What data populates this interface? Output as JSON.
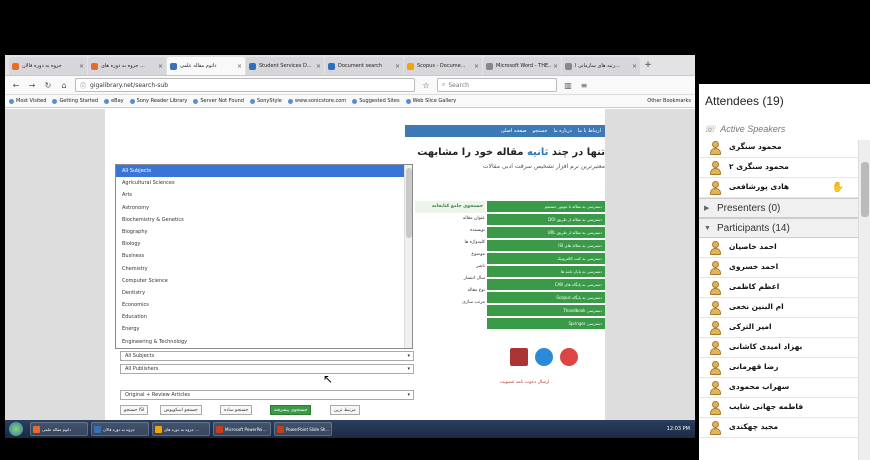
{
  "browser": {
    "tabs": [
      {
        "label": "جزوه به دوره فالان",
        "color": "#e86b2a",
        "active": false
      },
      {
        "label": "جزوه به دوره های ...",
        "color": "#e86b2a",
        "active": false
      },
      {
        "label": "داتوم مقاله علمی",
        "color": "#3b6fb6",
        "active": true
      },
      {
        "label": "Student Services D...",
        "color": "#2e6fbf",
        "active": false
      },
      {
        "label": "Document search",
        "color": "#2e6fbf",
        "active": false
      },
      {
        "label": "Scopus - Docume...",
        "color": "#f4a300",
        "active": false
      },
      {
        "label": "Microsoft Word - THE...",
        "color": "#888",
        "active": false
      },
      {
        "label": "رتبه های سازمانی ا...",
        "color": "#888",
        "active": false
      }
    ],
    "url": "gigalibrary.net/search-sub",
    "search_placeholder": "Search",
    "bookmarks": [
      "Most Visited",
      "Getting Started",
      "eBay",
      "Sony Reader Library",
      "Server Not Found",
      "SonyStyle",
      "www.sonicstore.com",
      "Suggested Sites",
      "Web Slice Gallery"
    ],
    "other_bookmarks": "Other Bookmarks"
  },
  "site": {
    "nav_items": [
      "صفحه اصلی",
      "جستجو",
      "درباره ما",
      "ارتباط با ما"
    ],
    "banner_title_a": "تنها در چند",
    "banner_title_accent": "ثانیه",
    "banner_title_b": "مقاله خود را مشابهت",
    "banner_subtitle": "معتبرترین نرم افزار تشخیص سرقت ادبی مقالات",
    "form_header": "جستجوی جامع کتابخانه",
    "form_labels": [
      "عنوان مقاله",
      "نویسنده",
      "کلیدواژه ها",
      "موضوع",
      "ناشر",
      "سال انتشار",
      "نوع مقاله",
      "مرتب سازی"
    ],
    "right_menu": [
      "دسترسی به مقاله با موتور جستجو",
      "دسترسی به مقاله از طریق DOI",
      "دسترسی به مقاله از طریق URL",
      "دسترسی به مقاله های ISI",
      "دسترسی به کتب الکترونیک",
      "دسترسی به پایان نامه ها",
      "دسترسی به پایگاه های CAB",
      "دسترسی به پایگاه Scopus",
      "دسترسی Thandbook",
      "دسترسی Springer"
    ],
    "invite_text": "ارسال دعوت نامه عضویت"
  },
  "subject_dropdown": {
    "options": [
      "All Subjects",
      "Agricultural Sciences",
      "Arts",
      "Astronomy",
      "Biochemistry & Genetics",
      "Biography",
      "Biology",
      "Business",
      "Chemistry",
      "Computer Science",
      "Dentistry",
      "Economics",
      "Education",
      "Energy",
      "Engineering & Technology"
    ],
    "selected_index": 0
  },
  "form": {
    "subjects_value": "All Subjects",
    "publishers_value": "All Publishers",
    "text_value": "",
    "type_value": "Original + Review Articles",
    "sort_label": "مرتبط ترین",
    "search_button": "جستجوی پیشرفته",
    "links": [
      "جستجو ساده",
      "جستجو اسکوپوس",
      "جستجو ISI"
    ]
  },
  "taskbar": {
    "items": [
      {
        "label": "داتوم مقاله علمی",
        "color": "#e86b2a"
      },
      {
        "label": "جزوه به دوره فالان",
        "color": "#3b6fb6"
      },
      {
        "label": "جزوه به دوره های ...",
        "color": "#f4a300"
      },
      {
        "label": "Microsoft PowerPoi...",
        "color": "#c43e1c"
      },
      {
        "label": "PowerPoint Slide Sh...",
        "color": "#c43e1c"
      }
    ],
    "clock": "12:03 PM"
  },
  "attendees": {
    "title": "Attendees",
    "count": "(19)",
    "active_speakers_label": "Active Speakers",
    "active_speakers": [
      "محمود سنگری",
      "محمود سنگری ۲",
      "هادی پورشافعی"
    ],
    "presenters_label": "Presenters",
    "presenters_count": "(0)",
    "participants_label": "Participants",
    "participants_count": "(14)",
    "participants": [
      "احمد خاصیان",
      "احمد خسروی",
      "اعظم کاظمی",
      "ام البنین نخعی",
      "امیر الترکی",
      "بهزاد امیدی کاشانی",
      "رضا قهرمانی",
      "سهراب محمودی",
      "فاطمه جهانی شایب",
      "مجید چهکندی"
    ]
  }
}
